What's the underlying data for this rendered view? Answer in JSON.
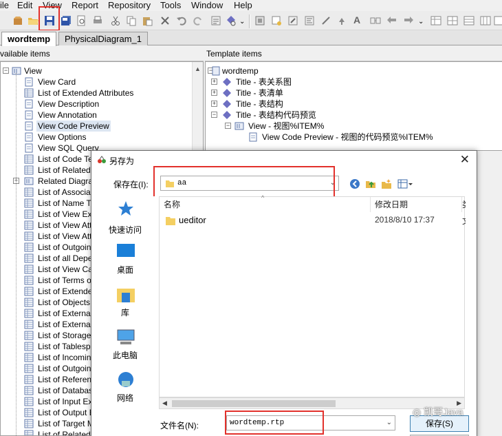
{
  "menu": [
    "ile",
    "Edit",
    "View",
    "Report",
    "Repository",
    "Tools",
    "Window",
    "Help"
  ],
  "toolbar": {
    "icons": [
      "open-folder-icon",
      "save-icon",
      "save-all-icon",
      "print-preview-icon",
      "print-icon",
      "cut-icon",
      "copy-icon",
      "paste-icon",
      "delete-icon",
      "undo-icon",
      "redo-icon",
      "properties-icon",
      "check-model-icon",
      "overflow-icon",
      "selector-icon",
      "paint-icon",
      "edit-icon",
      "align-icon",
      "text-icon",
      "pencil-icon",
      "arrow-icon",
      "text-a-icon",
      "link-icon",
      "back-icon",
      "overflow-icon",
      "grid-1-icon",
      "grid-2-icon",
      "grid-3-icon",
      "grid-4-icon",
      "grid-5-icon",
      "grid-6-icon"
    ]
  },
  "tabs": [
    "wordtemp",
    "PhysicalDiagram_1"
  ],
  "left_panel": {
    "header": "vailable items",
    "root": "View",
    "items": [
      "View Card",
      "List of Extended Attributes",
      "View Description",
      "View Annotation",
      "View Code Preview",
      "View Options",
      "View SQL Query",
      "List of Code Tem",
      "List of Related D",
      "Related Diagram",
      "List of Associate",
      "List of Name Ter",
      "List of View Exte",
      "List of View Atta",
      "List of View Atta",
      "List of Outgoing ",
      "List of all Depen",
      "List of View Calc",
      "List of Terms of ",
      "List of Extended ",
      "List of Objects in",
      "List of External In",
      "List of External E",
      "List of Storages ",
      "List of Tablespac",
      "List of Incoming ",
      "List of Outgoing ",
      "List of Reference",
      "List of Databases",
      "List of Input Exte",
      "List of Output Ex",
      "List of Target Ma",
      "List of Related A"
    ],
    "selected": "View Code Preview"
  },
  "right_panel": {
    "header": "Template items",
    "root": "wordtemp",
    "titles": [
      "Title - 表关系图",
      "Title - 表清单",
      "Title - 表结构",
      "Title - 表结构代码预览"
    ],
    "view_node": "View - 视图%ITEM%",
    "leaf": "View Code Preview - 视图的代码预览%ITEM%"
  },
  "dialog": {
    "title": "另存为",
    "close": "✕",
    "save_in_label": "保存在(I):",
    "save_in_value": "aa",
    "places": [
      "快速访问",
      "桌面",
      "库",
      "此电脑",
      "网络"
    ],
    "columns": [
      "名称",
      "修改日期",
      "类"
    ],
    "files": [
      {
        "name": "ueditor",
        "date": "2018/8/10 17:37",
        "type": "文"
      }
    ],
    "filename_label": "文件名(N):",
    "filename_value": "wordtemp.rtp",
    "save_button": "保存(S)"
  },
  "watermark": "凯哥Java",
  "colors": {
    "highlight": "#e2302b",
    "selection": "#dde6f2",
    "folder": "#f4cf62"
  }
}
